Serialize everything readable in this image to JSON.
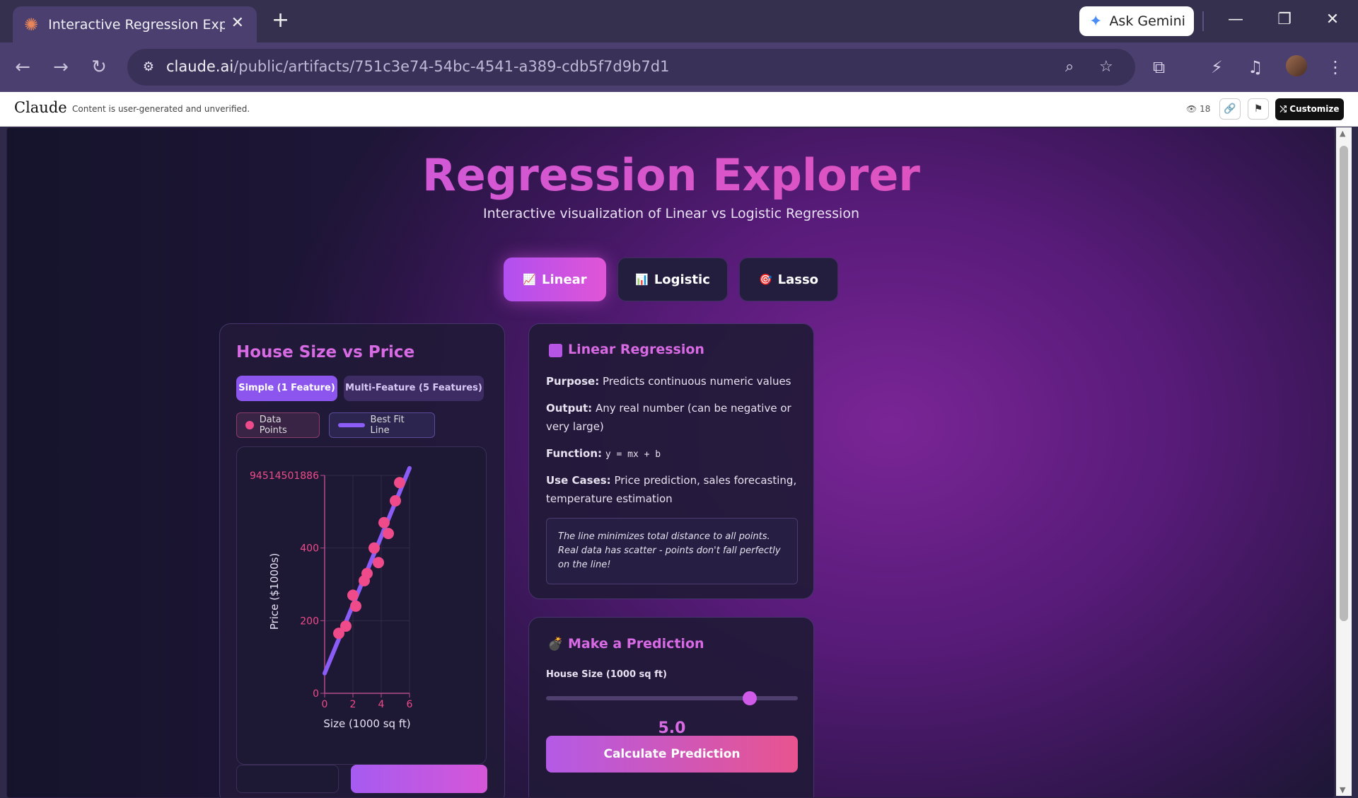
{
  "browser": {
    "tab_title": "Interactive Regression Explorer",
    "tab_close": "✕",
    "new_tab": "+",
    "ask_gemini": "Ask Gemini",
    "url_host": "claude.ai",
    "url_path": "/public/artifacts/751c3e74-54bc-4541-a389-cdb5f7d9b7d1"
  },
  "claude_bar": {
    "logo": "Claude",
    "disclaimer": "Content is user-generated and unverified.",
    "views": "18",
    "customize": "Customize"
  },
  "app": {
    "title": "Regression Explorer",
    "subtitle": "Interactive visualization of Linear vs Logistic Regression",
    "tabs": [
      {
        "icon": "📈",
        "label": "Linear"
      },
      {
        "icon": "📊",
        "label": "Logistic"
      },
      {
        "icon": "🎯",
        "label": "Lasso"
      }
    ],
    "chart_panel": {
      "title": "House Size vs Price",
      "subtabs": [
        "Simple (1 Feature)",
        "Multi-Feature (5 Features)"
      ],
      "legend": [
        "Data Points",
        "Best Fit Line"
      ]
    },
    "info_panel": {
      "title": "Linear Regression",
      "purpose_label": "Purpose:",
      "purpose": "Predicts continuous numeric values",
      "output_label": "Output:",
      "output": "Any real number (can be negative or very large)",
      "function_label": "Function:",
      "function": "y = mx + b",
      "usecases_label": "Use Cases:",
      "usecases": "Price prediction, sales forecasting, temperature estimation",
      "note": "The line minimizes total distance to all points. Real data has scatter - points don't fall perfectly on the line!"
    },
    "prediction_panel": {
      "title": "Make a Prediction",
      "slider_label": "House Size (1000 sq ft)",
      "slider_value": "5.0",
      "slider_fraction": 0.81,
      "button": "Calculate Prediction"
    }
  },
  "colors": {
    "accent": "#d86ae4",
    "point": "#ef4b8a",
    "line": "#8b5cf6"
  },
  "chart_data": {
    "type": "scatter",
    "xlabel": "Size (1000 sq ft)",
    "ylabel": "Price ($1000s)",
    "xlim": [
      0,
      6
    ],
    "ylim": [
      0,
      600
    ],
    "x_ticks": [
      "0",
      "2",
      "4",
      "6"
    ],
    "y_ticks": [
      "0",
      "200",
      "400",
      "94514501886"
    ],
    "grid": true,
    "series": [
      {
        "name": "Data Points",
        "type": "scatter",
        "x": [
          1.0,
          1.5,
          2.0,
          2.2,
          2.8,
          3.0,
          3.5,
          3.8,
          4.2,
          4.5,
          5.0,
          5.3
        ],
        "y": [
          165,
          185,
          270,
          240,
          310,
          330,
          400,
          360,
          470,
          440,
          530,
          580
        ]
      },
      {
        "name": "Best Fit Line",
        "type": "line",
        "x": [
          0,
          6
        ],
        "y": [
          55,
          620
        ]
      }
    ]
  }
}
